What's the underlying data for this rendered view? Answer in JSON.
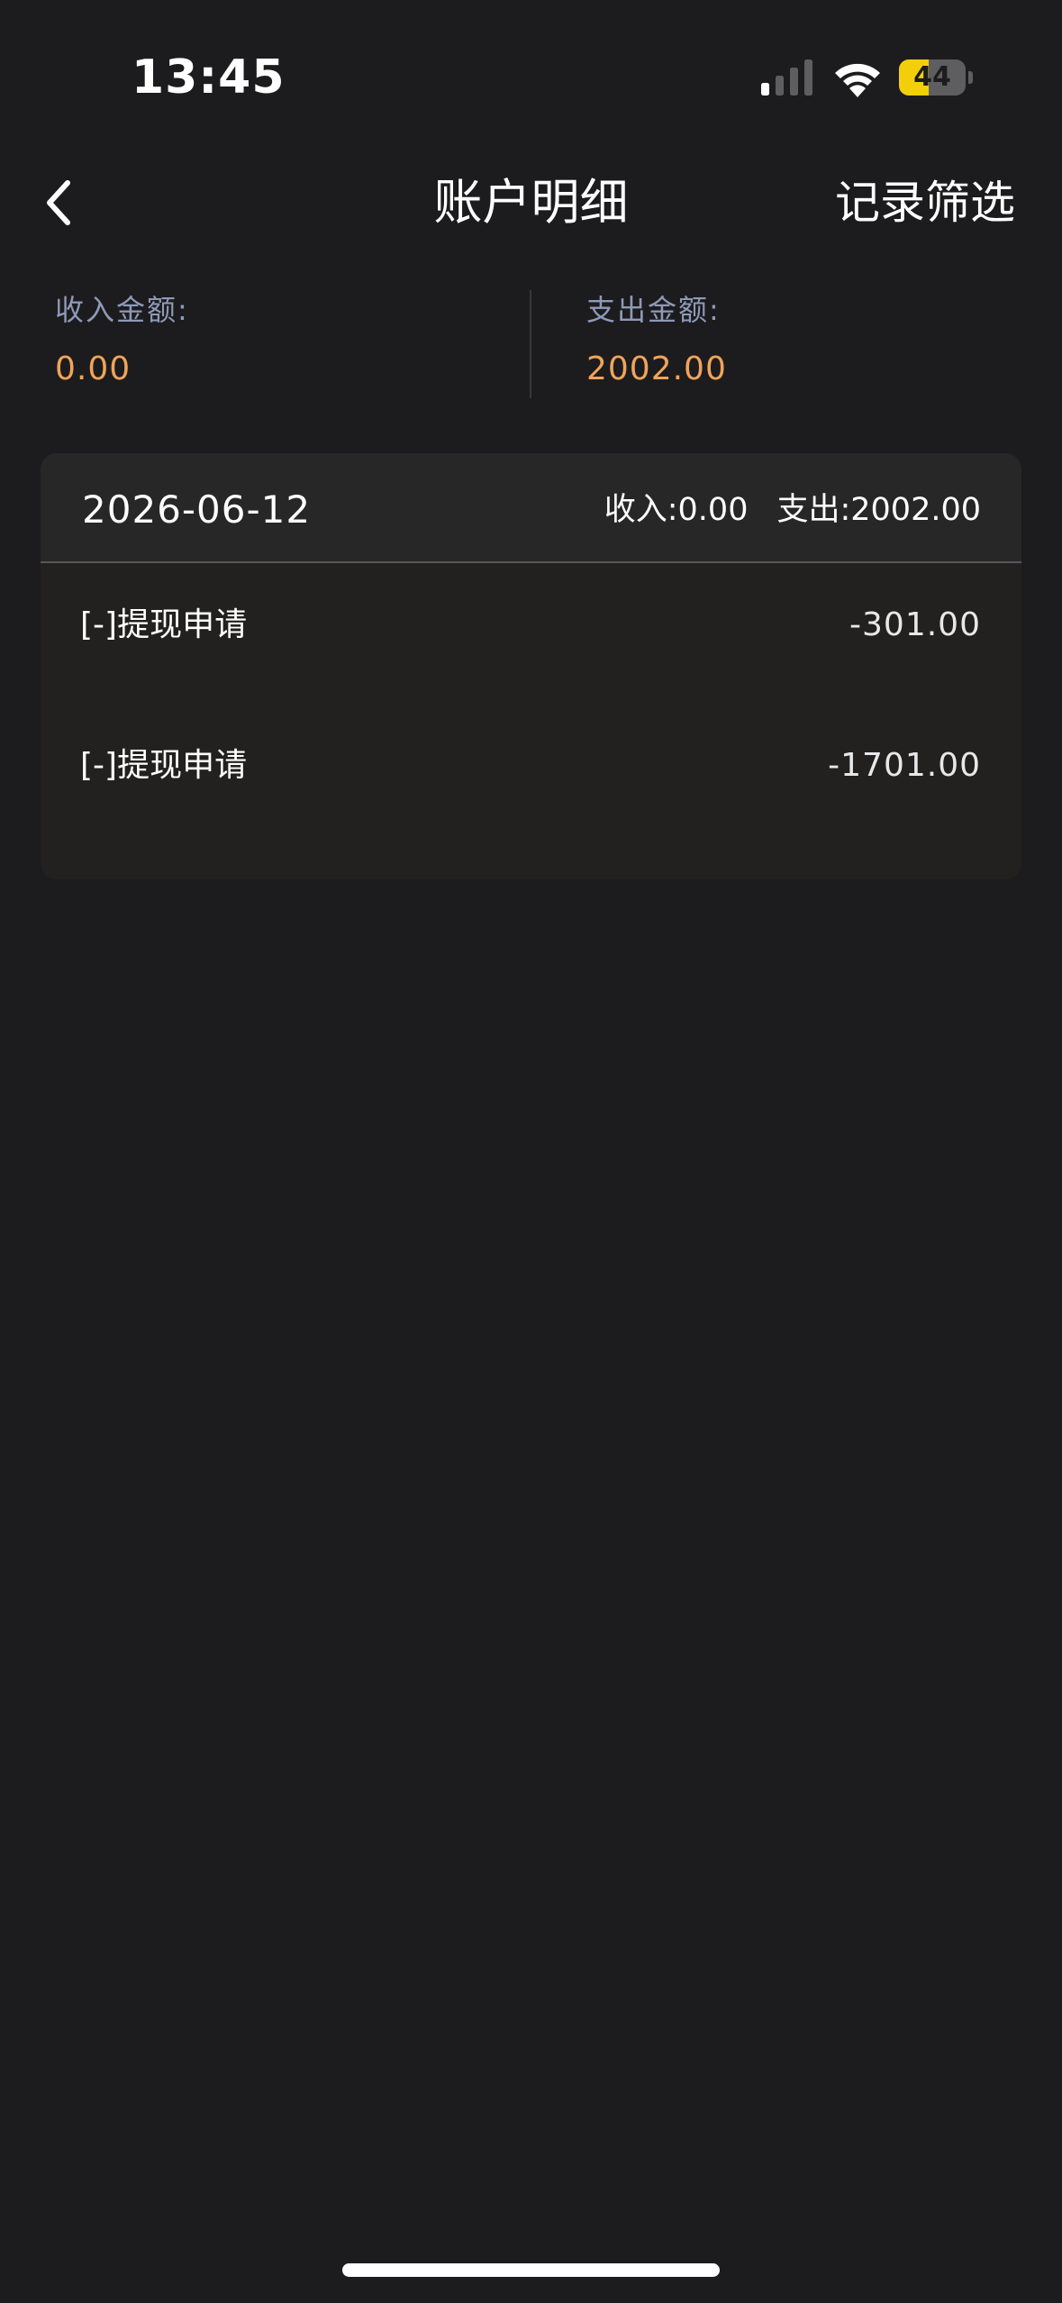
{
  "status_bar": {
    "time": "13:45",
    "battery_level": "44",
    "battery_fraction": 0.44,
    "battery_color": "#f3cf0b"
  },
  "nav": {
    "back_icon": "chevron-left-icon",
    "title": "账户明细",
    "filter_label": "记录筛选"
  },
  "summary": {
    "income_label": "收入金额:",
    "income_value": "0.00",
    "expense_label": "支出金额:",
    "expense_value": "2002.00",
    "value_color": "#f0a45a"
  },
  "records": [
    {
      "date": "2026-06-12",
      "income_total": "收入:0.00",
      "expense_total": "支出:2002.00",
      "items": [
        {
          "description": "[-]提现申请",
          "amount": "-301.00"
        },
        {
          "description": "[-]提现申请",
          "amount": "-1701.00"
        }
      ]
    }
  ]
}
